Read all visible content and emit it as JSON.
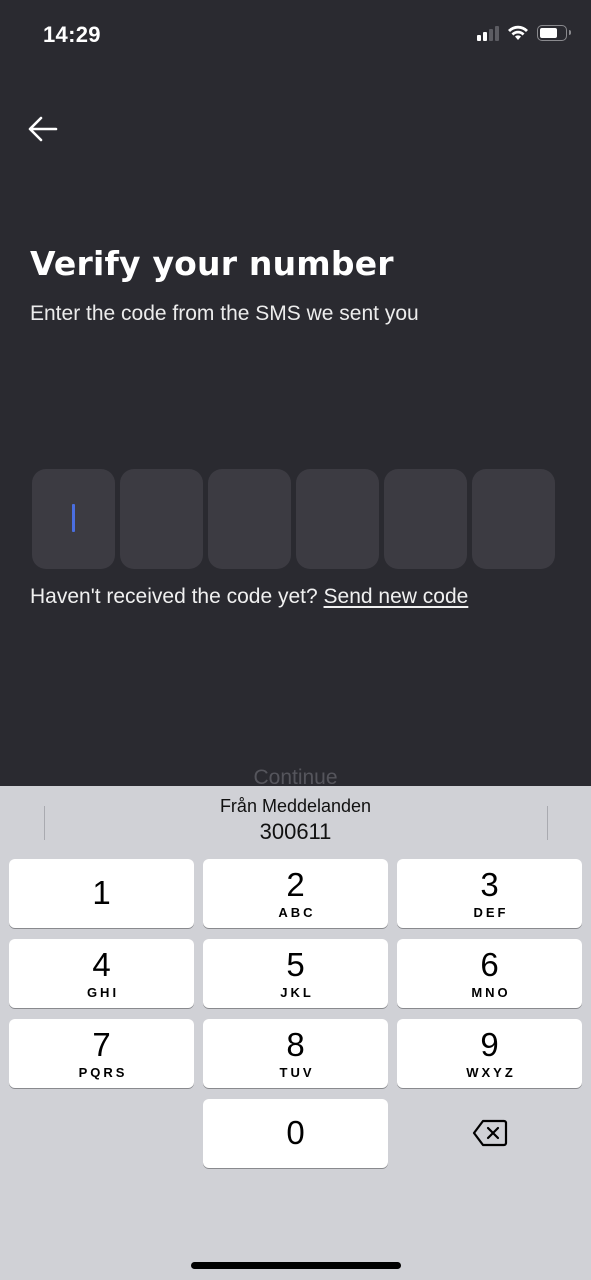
{
  "status_bar": {
    "time": "14:29",
    "icons": [
      "cellular-signal-icon",
      "wifi-icon",
      "battery-icon"
    ]
  },
  "header": {
    "back_icon": "arrow-left-icon"
  },
  "main": {
    "title": "Verify your number",
    "subtitle": "Enter the code from the SMS we sent you",
    "code_length": 6,
    "code_values": [
      "",
      "",
      "",
      "",
      "",
      ""
    ],
    "resend_prompt": "Haven't received the code yet?",
    "resend_link": "Send new code",
    "continue_label": "Continue",
    "accent_color": "#4a6ee0"
  },
  "keyboard": {
    "suggestion": {
      "source": "Från Meddelanden",
      "code": "300611"
    },
    "keys": [
      {
        "digit": "1",
        "letters": ""
      },
      {
        "digit": "2",
        "letters": "ABC"
      },
      {
        "digit": "3",
        "letters": "DEF"
      },
      {
        "digit": "4",
        "letters": "GHI"
      },
      {
        "digit": "5",
        "letters": "JKL"
      },
      {
        "digit": "6",
        "letters": "MNO"
      },
      {
        "digit": "7",
        "letters": "PQRS"
      },
      {
        "digit": "8",
        "letters": "TUV"
      },
      {
        "digit": "9",
        "letters": "WXYZ"
      },
      {
        "digit": "0",
        "letters": ""
      }
    ],
    "backspace_icon": "delete-backward-icon"
  }
}
